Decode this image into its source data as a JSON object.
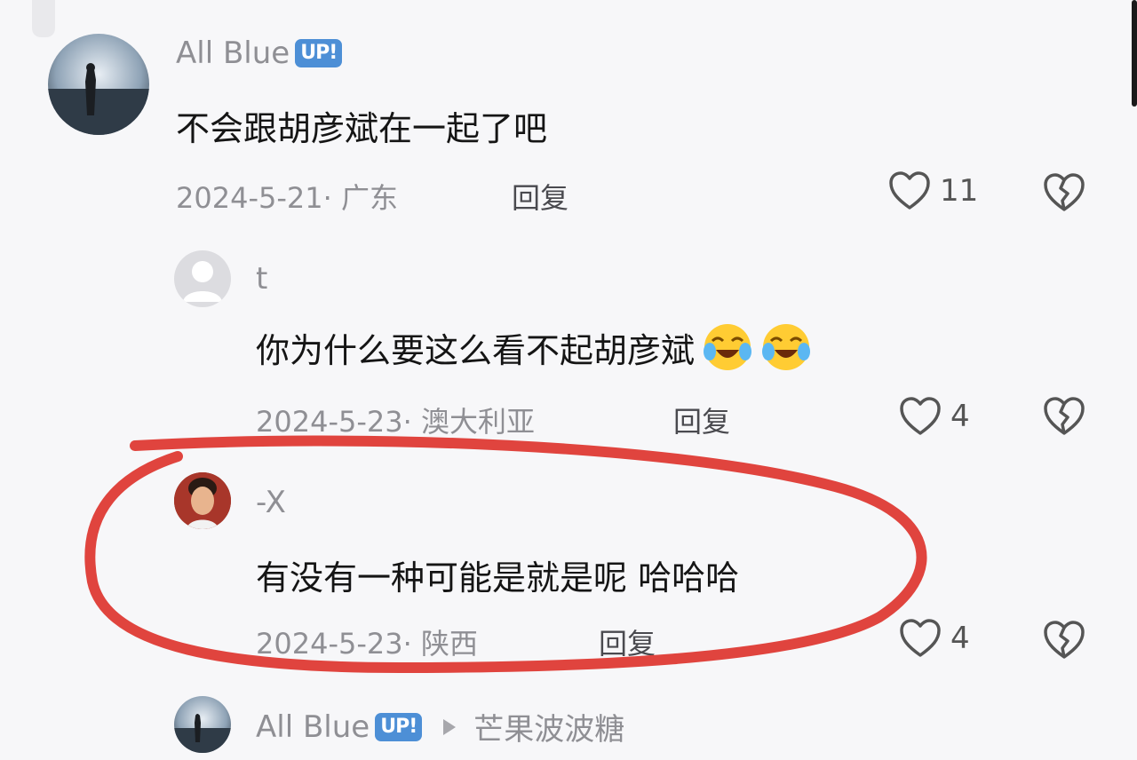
{
  "comments": [
    {
      "username": "All Blue",
      "badge": "UP!",
      "text": "不会跟胡彦斌在一起了吧",
      "date": "2024-5-21· 广东",
      "reply_label": "回复",
      "likes": "11"
    },
    {
      "username": "t",
      "text": "你为什么要这么看不起胡彦斌",
      "date": "2024-5-23· 澳大利亚",
      "reply_label": "回复",
      "likes": "4"
    },
    {
      "username": "-X",
      "text": "有没有一种可能是就是呢 哈哈哈",
      "date": "2024-5-23· 陕西",
      "reply_label": "回复",
      "likes": "4"
    },
    {
      "username": "All Blue",
      "badge": "UP!",
      "reply_to": "芒果波波糖"
    }
  ],
  "icons": {
    "like": "heart-outline-icon",
    "dislike": "broken-heart-icon",
    "emoji": "crying-laughing-emoji",
    "reply_arrow": "triangle-right-icon"
  },
  "colors": {
    "annotation": "#e0443e",
    "badge": "#4d8fd6",
    "meta": "#8f8f94"
  }
}
